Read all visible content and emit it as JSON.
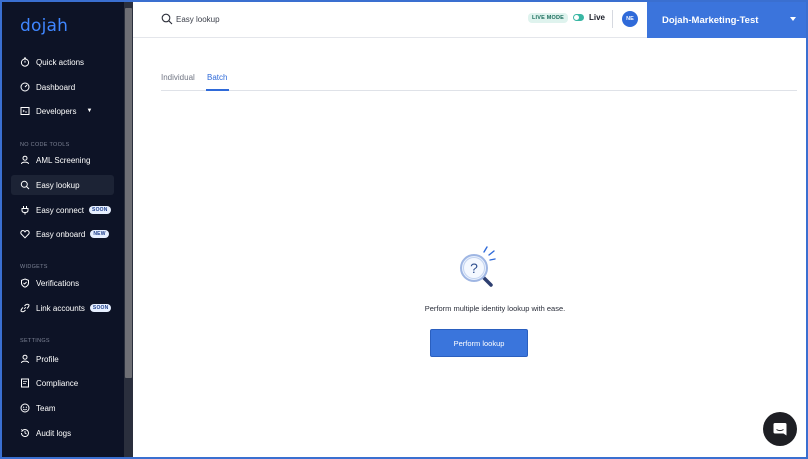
{
  "sidebar": {
    "logo": "dojah",
    "items": [
      {
        "label": "Quick actions",
        "icon": "stopwatch-icon"
      },
      {
        "label": "Dashboard",
        "icon": "gauge-icon"
      },
      {
        "label": "Developers",
        "icon": "code-icon"
      },
      {
        "label": "AML Screening",
        "icon": "user-icon"
      },
      {
        "label": "Easy lookup",
        "icon": "search-icon"
      },
      {
        "label": "Easy connect",
        "icon": "plug-icon",
        "badge": "SOON"
      },
      {
        "label": "Easy onboard",
        "icon": "heart-icon",
        "badge": "NEW"
      },
      {
        "label": "Verifications",
        "icon": "shield-icon"
      },
      {
        "label": "Link accounts",
        "icon": "link-icon",
        "badge": "SOON"
      },
      {
        "label": "Profile",
        "icon": "user-icon"
      },
      {
        "label": "Compliance",
        "icon": "document-icon"
      },
      {
        "label": "Team",
        "icon": "team-icon"
      },
      {
        "label": "Audit logs",
        "icon": "history-icon"
      }
    ],
    "sections": {
      "no_code": "NO CODE TOOLS",
      "widgets": "WIDGETS",
      "settings": "SETTINGS"
    }
  },
  "topbar": {
    "search_value": "Easy lookup",
    "live_mode_badge": "LIVE MODE",
    "live_label": "Live",
    "avatar_initials": "NE",
    "account_name": "Dojah-Marketing-Test"
  },
  "main": {
    "tabs": [
      {
        "label": "Individual",
        "active": false
      },
      {
        "label": "Batch",
        "active": true
      }
    ],
    "empty_text": "Perform multiple identity lookup with ease.",
    "perform_button": "Perform lookup"
  },
  "colors": {
    "sidebar_bg": "#0d1326",
    "accent": "#3a75dc",
    "live_toggle": "#3ab7a4"
  }
}
